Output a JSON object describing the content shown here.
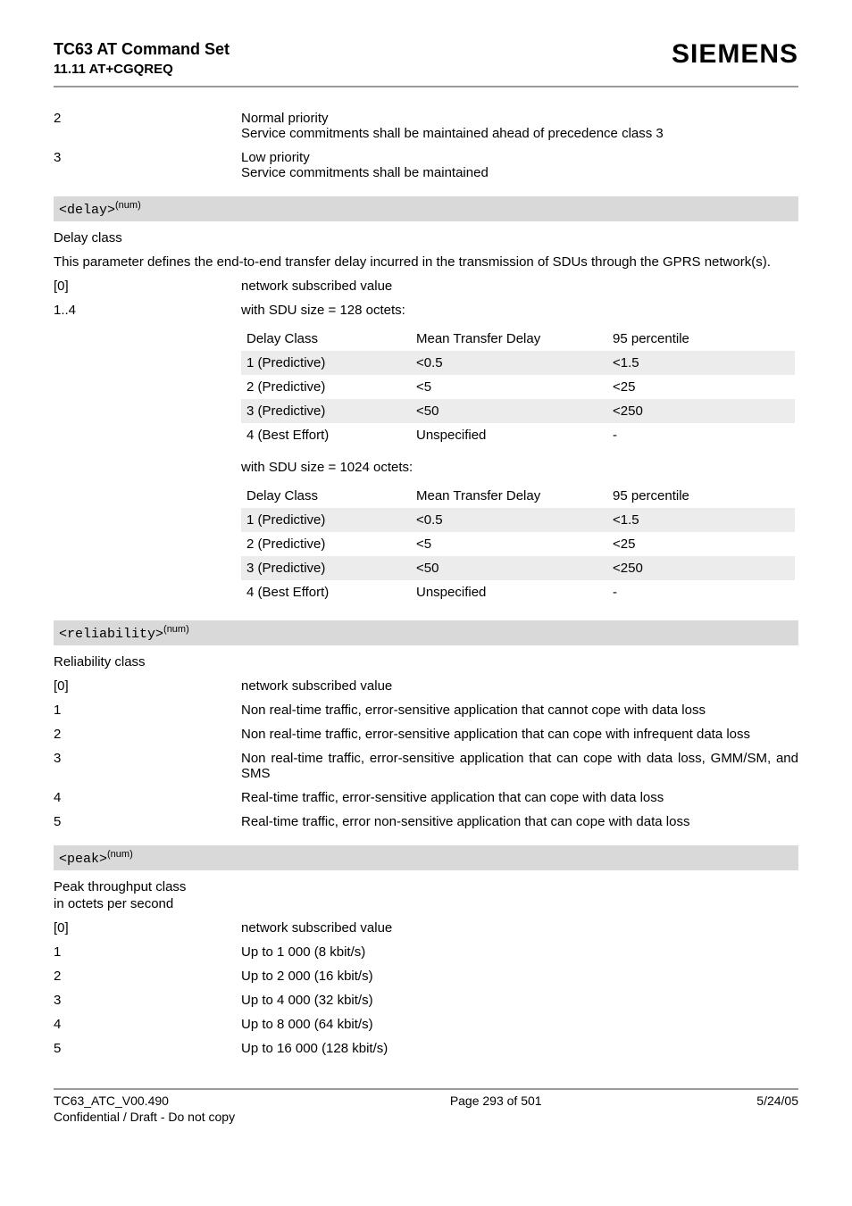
{
  "header": {
    "title": "TC63 AT Command Set",
    "sub": "11.11 AT+CGQREQ",
    "brand": "SIEMENS"
  },
  "priority_rows": [
    {
      "k": "2",
      "v": "Normal priority\nService commitments shall be maintained ahead of precedence class 3"
    },
    {
      "k": "3",
      "v": "Low priority\nService commitments shall be maintained"
    }
  ],
  "delay": {
    "param_code": "<delay>",
    "param_sup": "(num)",
    "label": "Delay class",
    "desc": "This parameter defines the end-to-end transfer delay incurred in the transmission of SDUs through the GPRS network(s).",
    "rows": [
      {
        "k": "[0]",
        "v": "network subscribed value"
      },
      {
        "k": "1..4",
        "v": "with SDU size = 128 octets:"
      }
    ],
    "between_caption": "with SDU size = 1024 octets:"
  },
  "chart_data": [
    {
      "type": "table",
      "title": "with SDU size = 128 octets:",
      "columns": [
        "Delay Class",
        "Mean Transfer Delay",
        "95 percentile"
      ],
      "rows": [
        [
          "1 (Predictive)",
          "<0.5",
          "<1.5"
        ],
        [
          "2 (Predictive)",
          "<5",
          "<25"
        ],
        [
          "3 (Predictive)",
          "<50",
          "<250"
        ],
        [
          "4 (Best Effort)",
          "Unspecified",
          "-"
        ]
      ]
    },
    {
      "type": "table",
      "title": "with SDU size = 1024 octets:",
      "columns": [
        "Delay Class",
        "Mean Transfer Delay",
        "95 percentile"
      ],
      "rows": [
        [
          "1 (Predictive)",
          "<0.5",
          "<1.5"
        ],
        [
          "2 (Predictive)",
          "<5",
          "<25"
        ],
        [
          "3 (Predictive)",
          "<50",
          "<250"
        ],
        [
          "4 (Best Effort)",
          "Unspecified",
          "-"
        ]
      ]
    }
  ],
  "reliability": {
    "param_code": "<reliability>",
    "param_sup": "(num)",
    "label": "Reliability class",
    "rows": [
      {
        "k": "[0]",
        "v": "network subscribed value"
      },
      {
        "k": "1",
        "v": "Non real-time traffic, error-sensitive application that cannot cope with data loss"
      },
      {
        "k": "2",
        "v": "Non real-time traffic, error-sensitive application that can cope with infrequent data loss"
      },
      {
        "k": "3",
        "v": "Non real-time traffic, error-sensitive application that can cope with data loss, GMM/SM, and SMS"
      },
      {
        "k": "4",
        "v": "Real-time traffic, error-sensitive application that can cope with data loss"
      },
      {
        "k": "5",
        "v": "Real-time traffic, error non-sensitive application that can cope with data loss"
      }
    ]
  },
  "peak": {
    "param_code": "<peak>",
    "param_sup": "(num)",
    "label": "Peak throughput class",
    "sublabel": "in octets per second",
    "rows": [
      {
        "k": "[0]",
        "v": "network subscribed value"
      },
      {
        "k": "1",
        "v": "Up to 1 000 (8 kbit/s)"
      },
      {
        "k": "2",
        "v": "Up to 2 000 (16 kbit/s)"
      },
      {
        "k": "3",
        "v": "Up to 4 000 (32 kbit/s)"
      },
      {
        "k": "4",
        "v": "Up to 8 000 (64 kbit/s)"
      },
      {
        "k": "5",
        "v": "Up to 16 000 (128 kbit/s)"
      }
    ]
  },
  "footer": {
    "left1": "TC63_ATC_V00.490",
    "left2": "Confidential / Draft - Do not copy",
    "center": "Page 293 of 501",
    "right": "5/24/05"
  }
}
